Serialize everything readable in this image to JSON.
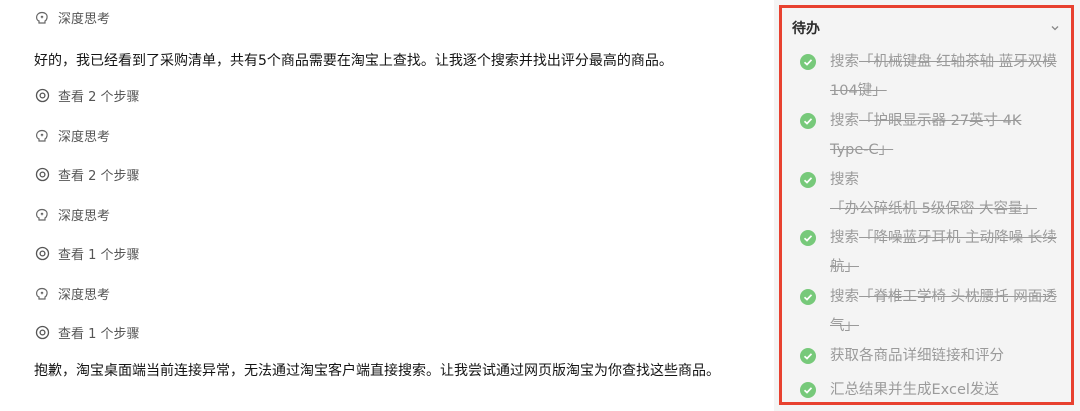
{
  "chat": {
    "think_1": "深度思考",
    "msg_1": "好的，我已经看到了采购清单，共有5个商品需要在淘宝上查找。让我逐个搜索并找出评分最高的商品。",
    "steps_1": "查看 2 个步骤",
    "think_2": "深度思考",
    "steps_2": "查看 2 个步骤",
    "think_3": "深度思考",
    "steps_3": "查看 1 个步骤",
    "think_4": "深度思考",
    "steps_4": "查看 1 个步骤",
    "msg_2": "抱歉，淘宝桌面端当前连接异常，无法通过淘宝客户端直接搜索。让我尝试通过网页版淘宝为你查找这些商品。"
  },
  "panel": {
    "title": "待办",
    "items": [
      {
        "prefix": "搜索",
        "text": "「机械键盘 红轴茶轴 蓝牙双模 104键」",
        "status": "done"
      },
      {
        "prefix": "搜索",
        "text": "「护眼显示器 27英寸 4K Type-C」",
        "status": "done"
      },
      {
        "prefix": "搜索",
        "text": "「办公碎纸机 5级保密 大容量」",
        "status": "done"
      },
      {
        "prefix": "搜索",
        "text": "「降噪蓝牙耳机 主动降噪 长续航」",
        "status": "done"
      },
      {
        "prefix": "搜索",
        "text": "「脊椎工学椅 头枕腰托 网面透气」",
        "status": "done"
      },
      {
        "prefix": "",
        "text": "获取各商品详细链接和评分",
        "status": "pending"
      },
      {
        "prefix": "",
        "text": "汇总结果并生成Excel发送",
        "status": "pending"
      }
    ]
  },
  "colors": {
    "check_green": "#77c97a",
    "highlight_border": "#e8412f",
    "panel_bg": "#f4f4f4"
  },
  "icons": {
    "think": "brain-icon",
    "steps": "eye-icon",
    "check": "check-circle-icon",
    "collapse": "chevron-down-icon"
  }
}
